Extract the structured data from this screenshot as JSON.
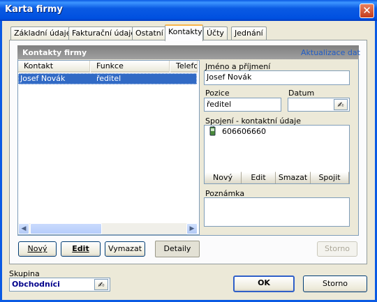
{
  "window": {
    "title": "Karta firmy",
    "close_label": "✕"
  },
  "tabs": [
    {
      "label": "Základní údaje"
    },
    {
      "label": "Fakturační údaje"
    },
    {
      "label": "Ostatní"
    },
    {
      "label": "Kontakty",
      "active": true
    },
    {
      "label": "Účty"
    },
    {
      "label": "Jednání"
    }
  ],
  "group": {
    "title": "Kontakty firmy",
    "refresh_link": "Aktualizace dat"
  },
  "list": {
    "columns": [
      "Kontakt",
      "Funkce",
      "Telefon"
    ],
    "rows": [
      {
        "kontakt": "Josef Novák",
        "funkce": "ředitel"
      }
    ]
  },
  "form": {
    "name_label": "Jméno a příjmení",
    "name_value": "Josef Novák",
    "position_label": "Pozice",
    "position_value": "ředitel",
    "date_label": "Datum",
    "date_value": "",
    "connection_label": "Spojení -  kontaktní údaje",
    "connections": [
      {
        "icon": "mobile-phone-icon",
        "value": "606606660"
      }
    ],
    "connection_buttons": [
      "Nový",
      "Edit",
      "Smazat",
      "Spojit"
    ],
    "note_label": "Poznámka",
    "note_value": ""
  },
  "actions": {
    "new_label": "Nový",
    "edit_label": "Edit",
    "delete_label": "Vymazat",
    "detail_label": "Detaily",
    "storno_disabled_label": "Storno"
  },
  "footer": {
    "group_label": "Skupina",
    "group_value": "Obchodníci",
    "ok_label": "OK",
    "storno_label": "Storno"
  },
  "colors": {
    "titlebar": "#0a5ae3",
    "selection": "#316ac5",
    "link": "#215dc6",
    "group_value": "#00008b"
  }
}
